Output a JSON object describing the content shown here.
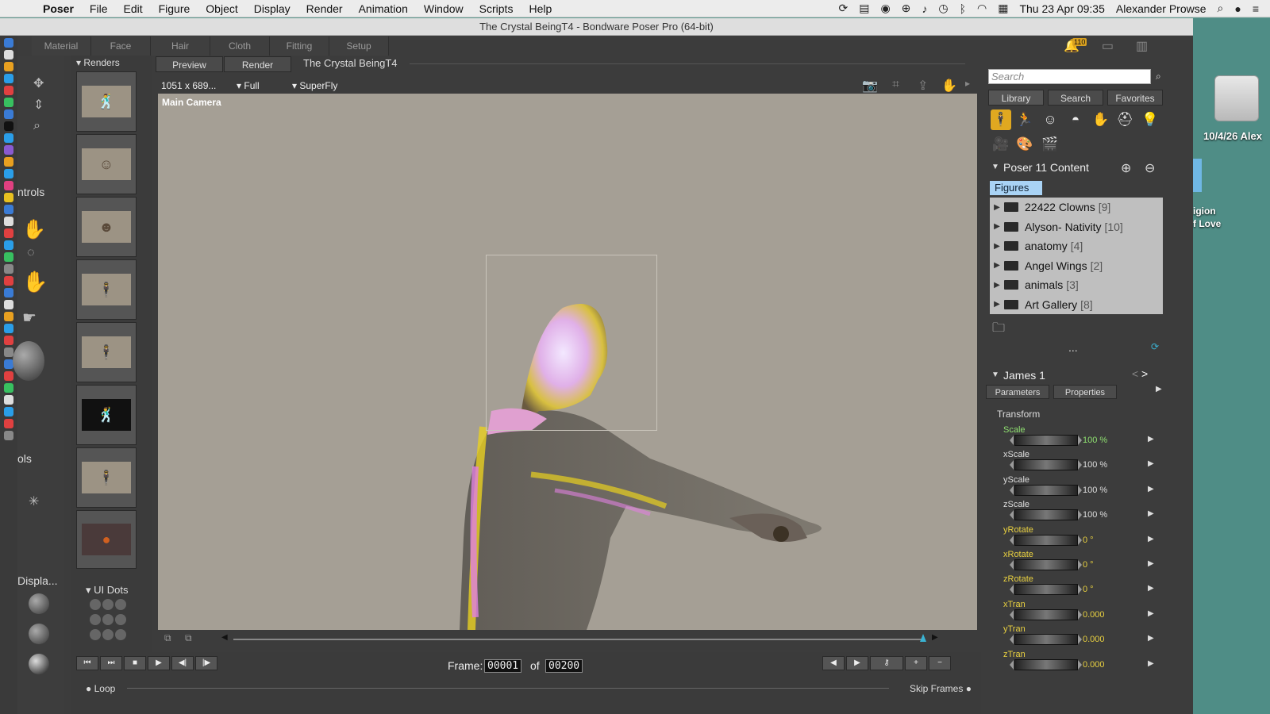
{
  "menubar": {
    "app": "Poser",
    "items": [
      "File",
      "Edit",
      "Figure",
      "Object",
      "Display",
      "Render",
      "Animation",
      "Window",
      "Scripts",
      "Help"
    ],
    "datetime": "Thu 23 Apr  09:35",
    "user": "Alexander Prowse"
  },
  "window": {
    "title": "The Crystal BeingT4 - Bondware Poser Pro  (64-bit)"
  },
  "room_tabs": [
    "Material",
    "Face",
    "Hair",
    "Cloth",
    "Fitting",
    "Setup"
  ],
  "notifications_badge": "110",
  "left_panels": {
    "renders_title": "Renders",
    "controls_fragment": "ntrols",
    "tools_fragment": "ols",
    "display_fragment": "Displa...",
    "ui_dots_title": "UI Dots"
  },
  "document": {
    "tabs": [
      "Preview",
      "Render"
    ],
    "title": "The Crystal BeingT4",
    "resolution": "1051 x 689...",
    "size_mode": "Full",
    "engine": "SuperFly",
    "camera": "Main Camera"
  },
  "animation": {
    "frame_label": "Frame:",
    "current_frame": "00001",
    "of_label": "of",
    "total_frames": "00200",
    "loop_label": "Loop",
    "skip_frames_label": "Skip Frames"
  },
  "library": {
    "search_placeholder": "Search",
    "tabs": [
      "Library",
      "Search",
      "Favorites"
    ],
    "content_title": "Poser 11 Content",
    "active_category": "Figures",
    "folders": [
      {
        "name": "22422 Clowns",
        "count": "[9]"
      },
      {
        "name": "Alyson- Nativity",
        "count": "[10]"
      },
      {
        "name": "anatomy",
        "count": "[4]"
      },
      {
        "name": "Angel Wings",
        "count": "[2]"
      },
      {
        "name": "animals",
        "count": "[3]"
      },
      {
        "name": "Art Gallery",
        "count": "[8]"
      }
    ],
    "more": "..."
  },
  "parameters": {
    "figure_name": "James 1",
    "tabs": [
      "Parameters",
      "Properties"
    ],
    "group": "Transform",
    "rows": [
      {
        "name": "Scale",
        "value": "100 %",
        "color": "#8fe070"
      },
      {
        "name": "xScale",
        "value": "100 %",
        "color": "#dddddd"
      },
      {
        "name": "yScale",
        "value": "100 %",
        "color": "#dddddd"
      },
      {
        "name": "zScale",
        "value": "100 %",
        "color": "#dddddd"
      },
      {
        "name": "yRotate",
        "value": "0 °",
        "color": "#e8d040"
      },
      {
        "name": "xRotate",
        "value": "0 °",
        "color": "#e8d040"
      },
      {
        "name": "zRotate",
        "value": "0 °",
        "color": "#e8d040"
      },
      {
        "name": "xTran",
        "value": "0.000",
        "color": "#e8d040"
      },
      {
        "name": "yTran",
        "value": "0.000",
        "color": "#e8d040"
      },
      {
        "name": "zTran",
        "value": "0.000",
        "color": "#e8d040"
      }
    ]
  },
  "desktop": {
    "drive_label": "10/4/26 Alex",
    "partial_label_1": "igion",
    "partial_label_2": "f Love"
  }
}
